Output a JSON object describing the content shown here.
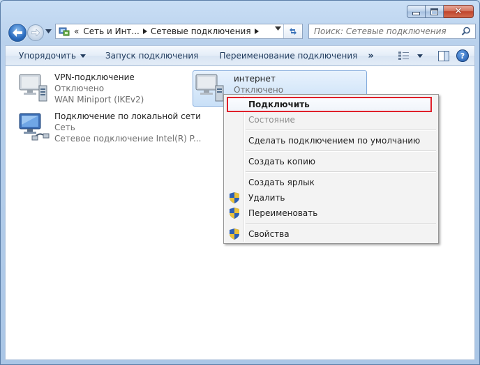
{
  "window": {
    "close_glyph": "✕"
  },
  "nav": {
    "address": {
      "overflow": "«",
      "segments": [
        "Сеть и Инт...",
        "Сетевые подключения"
      ]
    },
    "search_placeholder": "Поиск: Сетевые подключения"
  },
  "commandbar": {
    "organize": "Упорядочить",
    "start": "Запуск подключения",
    "rename": "Переименование подключения",
    "more": "»",
    "help": "?"
  },
  "connections": [
    {
      "name": "VPN-подключение",
      "status": "Отключено",
      "device": "WAN Miniport (IKEv2)"
    },
    {
      "name": "Подключение по локальной сети",
      "status": "Сеть",
      "device": "Сетевое подключение Intel(R) P..."
    },
    {
      "name": "интернет",
      "status": "Отключено"
    }
  ],
  "context_menu": {
    "connect": "Подключить",
    "status": "Состояние",
    "set_default": "Сделать подключением по умолчанию",
    "copy": "Создать копию",
    "shortcut": "Создать ярлык",
    "delete": "Удалить",
    "rename": "Переименовать",
    "properties": "Свойства"
  },
  "colors": {
    "highlight_border": "#e0202a",
    "selection_fill": "#c9e0f7"
  }
}
